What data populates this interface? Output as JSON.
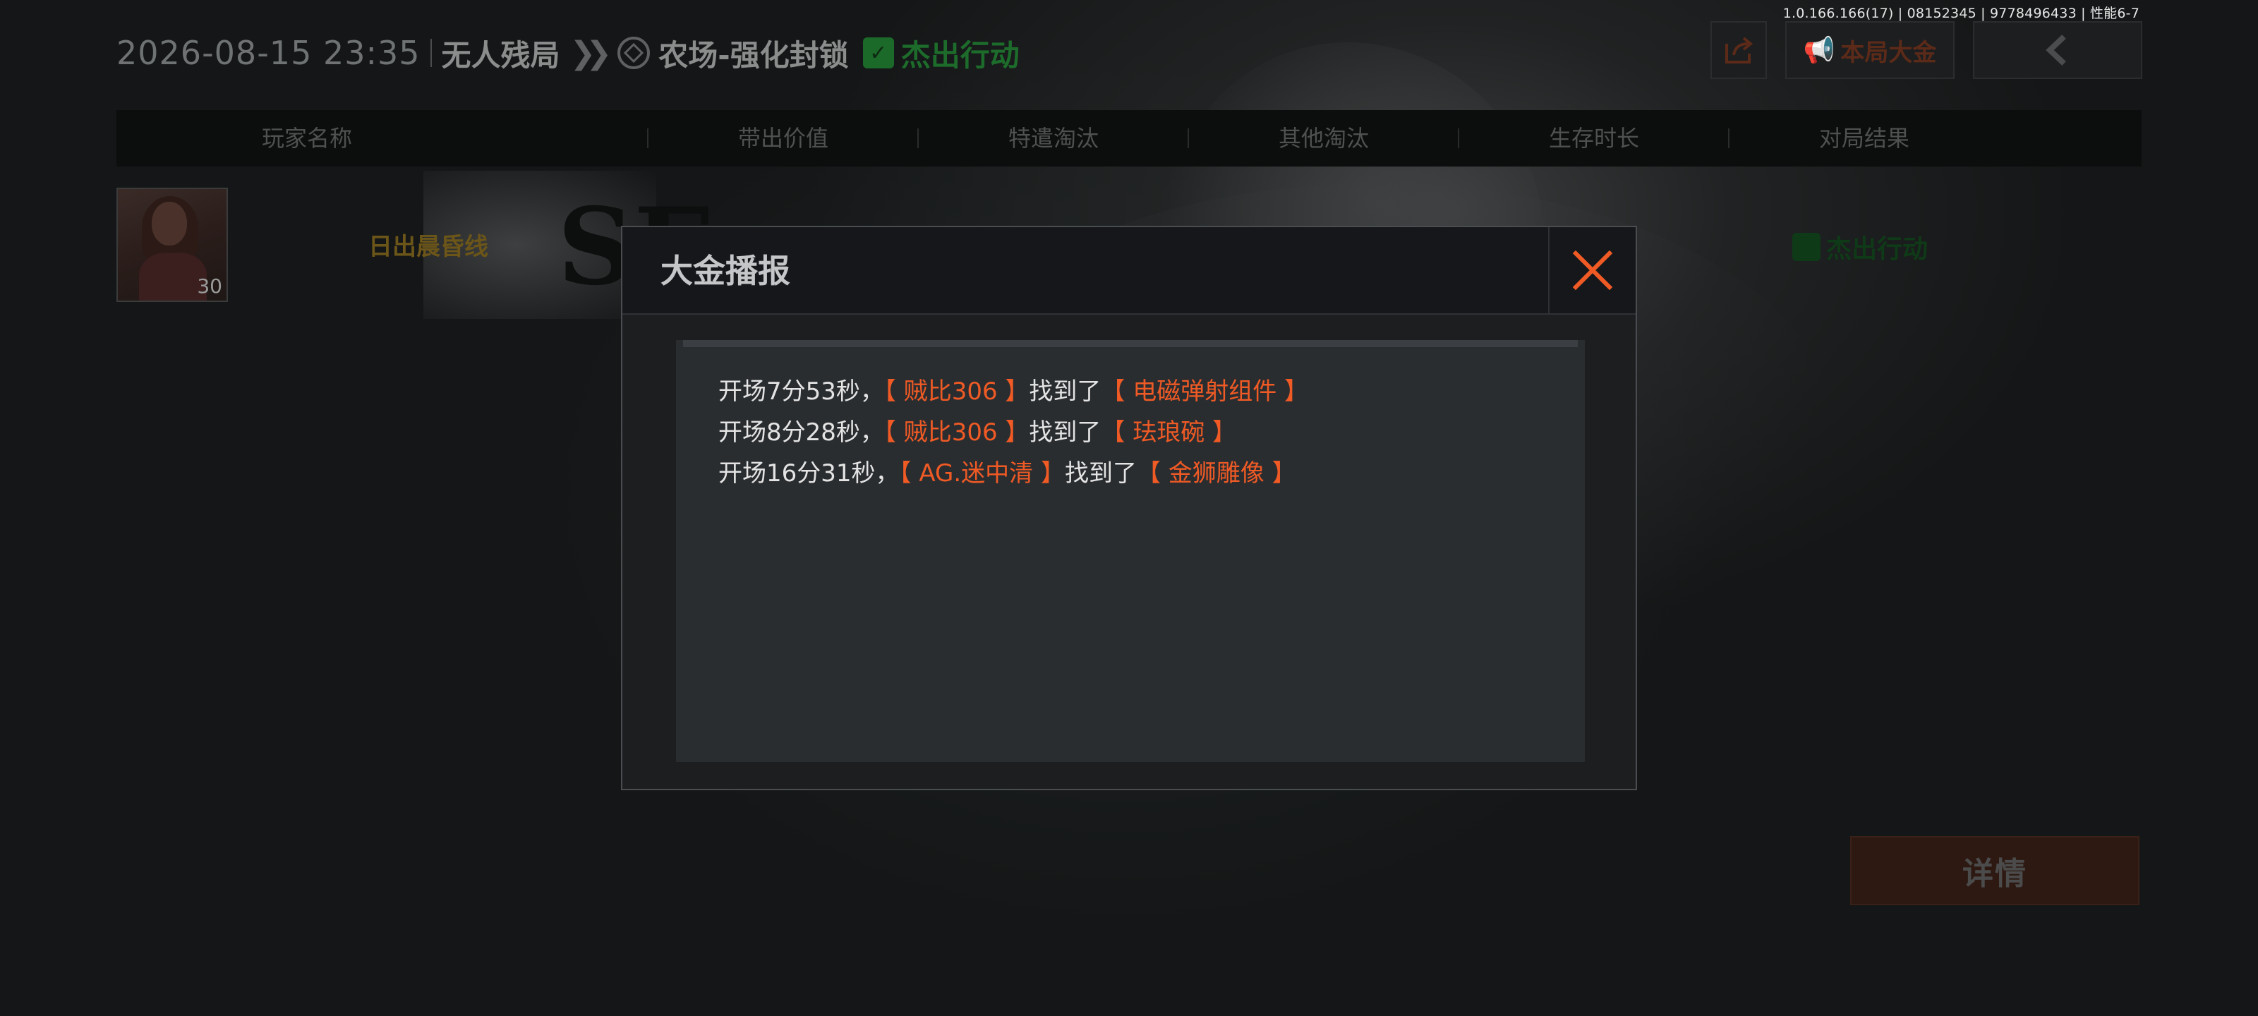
{
  "version_info": "1.0.166.166(17) | 08152345 | 9778496433 | 性能6-7",
  "match": {
    "datetime": "2026-08-15 23:35",
    "mode": "无人残局",
    "map": "农场-强化封锁",
    "status": "杰出行动",
    "status_color": "#1d6c2b"
  },
  "toolbar": {
    "share_icon": "share-icon",
    "gold_label": "本局大金",
    "back_icon": "chevron-left-icon"
  },
  "table": {
    "headers": [
      "玩家名称",
      "带出价值",
      "特遣淘汰",
      "其他淘汰",
      "生存时长",
      "对局结果"
    ],
    "rows": [
      {
        "player_name": "日出晨昏线",
        "level": "30",
        "result": "杰出行动"
      }
    ]
  },
  "detail_label": "详情",
  "modal": {
    "title": "大金播报",
    "accent_color": "#ef5a25",
    "entries": [
      {
        "time": "开场7分53秒，",
        "player": "【 贼比306 】",
        "found": "找到了",
        "item": "【 电磁弹射组件 】"
      },
      {
        "time": "开场8分28秒，",
        "player": "【 贼比306 】",
        "found": "找到了",
        "item": "【 珐琅碗 】"
      },
      {
        "time": "开场16分31秒，",
        "player": "【 AG.迷中清 】",
        "found": "找到了",
        "item": "【 金狮雕像 】"
      }
    ]
  }
}
